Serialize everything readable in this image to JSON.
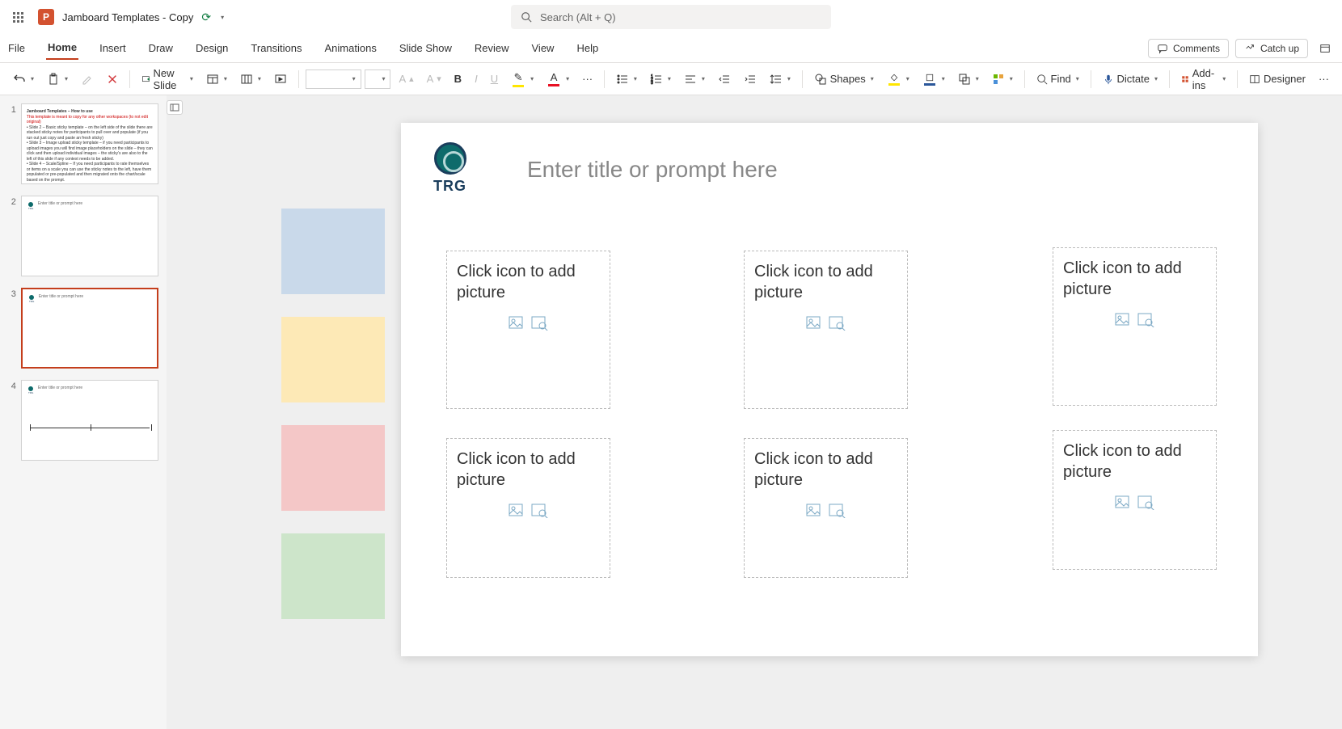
{
  "app": {
    "letter": "P",
    "doc_title": "Jamboard Templates  - Copy"
  },
  "search": {
    "placeholder": "Search (Alt + Q)"
  },
  "tabs": {
    "file": "File",
    "home": "Home",
    "insert": "Insert",
    "draw": "Draw",
    "design": "Design",
    "transitions": "Transitions",
    "animations": "Animations",
    "slideshow": "Slide Show",
    "review": "Review",
    "view": "View",
    "help": "Help"
  },
  "pills": {
    "comments": "Comments",
    "catchup": "Catch up"
  },
  "ribbon": {
    "newslide": "New Slide",
    "shapes": "Shapes",
    "find": "Find",
    "dictate": "Dictate",
    "addins": "Add-ins",
    "designer": "Designer"
  },
  "thumbs": {
    "n1": "1",
    "n2": "2",
    "n3": "3",
    "n4": "4",
    "t1_title": "Jamboard Templates – How to use",
    "t1_red": "This template is meant to copy for any other workspaces (to not edit original)",
    "t1_body": "• Slide 2 – Basic sticky template – on the left side of the slide there are stacked sticky notes for participants to pull over and populate (if you run out just copy and paste an fresh sticky)\n• Slide 3 – Image upload sticky template – if you need participants to upload images you will find image placeholders on the slide – they can click and then upload individual images – the sticky's are also to the left of this slide if any context needs to be added.\n• Slide 4 – Scale/Spline – If you need participants to rate themselves or items on a scale you can use the sticky notes to the left, have them populated or pre-populated and then migrated onto the chart/scale based on the prompt.",
    "mini_title": "Enter title or prompt here"
  },
  "slide": {
    "logo_text": "TRG",
    "title": "Enter title or prompt here",
    "pic_label": "Click icon to add picture"
  },
  "stickies": {
    "c1": "#c9d9ea",
    "c2": "#fde9b6",
    "c3": "#f4c7c7",
    "c4": "#cde5ca"
  }
}
